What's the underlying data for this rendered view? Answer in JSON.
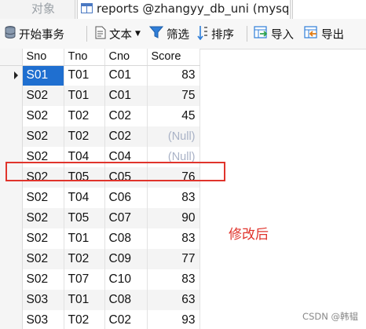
{
  "tabs": {
    "objects_label": "对象",
    "active_label": "reports @zhangyy_db_uni (mysql) - ..."
  },
  "toolbar": {
    "begin_transaction": "开始事务",
    "text": "文本",
    "filter": "筛选",
    "sort": "排序",
    "import": "导入",
    "export": "导出"
  },
  "table": {
    "columns": [
      "Sno",
      "Tno",
      "Cno",
      "Score"
    ],
    "null_label": "(Null)",
    "rows": [
      {
        "sno": "S01",
        "tno": "T01",
        "cno": "C01",
        "score": "83"
      },
      {
        "sno": "S02",
        "tno": "T01",
        "cno": "C01",
        "score": "75"
      },
      {
        "sno": "S02",
        "tno": "T02",
        "cno": "C02",
        "score": "45"
      },
      {
        "sno": "S02",
        "tno": "T02",
        "cno": "C02",
        "score": "(Null)"
      },
      {
        "sno": "S02",
        "tno": "T04",
        "cno": "C04",
        "score": "(Null)"
      },
      {
        "sno": "S02",
        "tno": "T05",
        "cno": "C05",
        "score": "76"
      },
      {
        "sno": "S02",
        "tno": "T04",
        "cno": "C06",
        "score": "83"
      },
      {
        "sno": "S02",
        "tno": "T05",
        "cno": "C07",
        "score": "90"
      },
      {
        "sno": "S02",
        "tno": "T01",
        "cno": "C08",
        "score": "83"
      },
      {
        "sno": "S02",
        "tno": "T02",
        "cno": "C09",
        "score": "77"
      },
      {
        "sno": "S02",
        "tno": "T07",
        "cno": "C10",
        "score": "83"
      },
      {
        "sno": "S03",
        "tno": "T01",
        "cno": "C08",
        "score": "63"
      },
      {
        "sno": "S03",
        "tno": "T02",
        "cno": "C02",
        "score": "93"
      }
    ]
  },
  "annotation": "修改后",
  "watermark": "CSDN @韩韫",
  "colors": {
    "selection": "#1f6fd0",
    "highlight": "#e0342c",
    "null_text": "#a9b2c6"
  }
}
